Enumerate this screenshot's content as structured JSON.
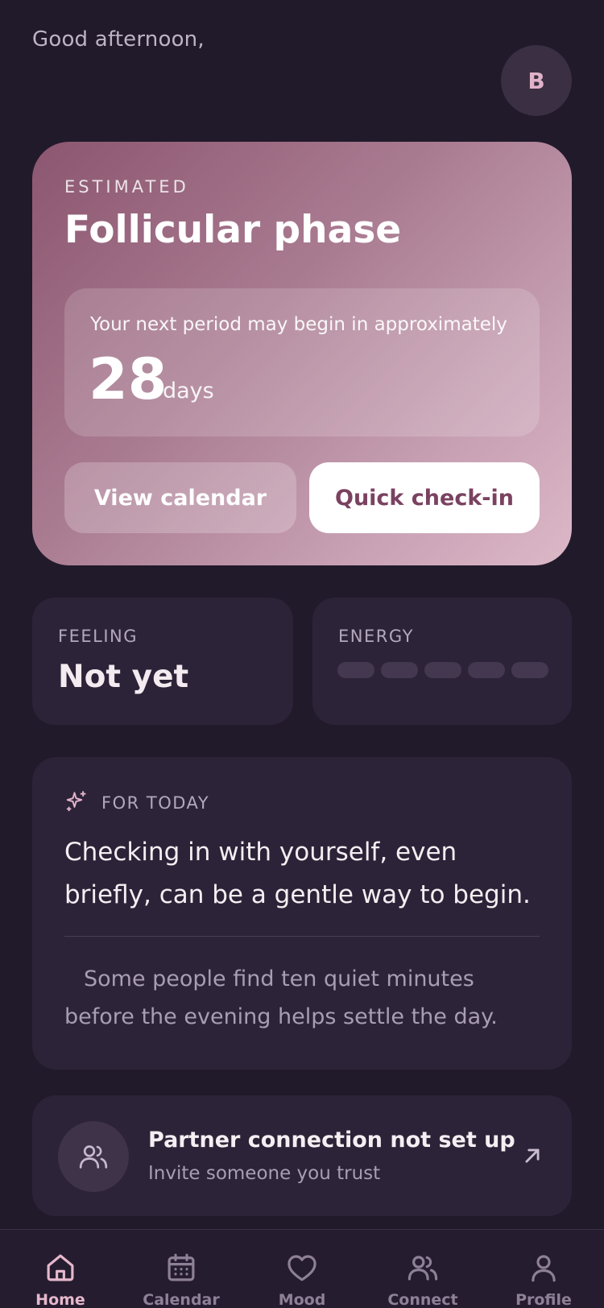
{
  "header": {
    "greeting": "Good afternoon,",
    "avatar_initial": "B"
  },
  "phase_card": {
    "eyebrow": "ESTIMATED",
    "title": "Follicular phase",
    "next_period_text": "Your next period may begin in approximately",
    "days_value": "28",
    "days_unit": "days",
    "view_calendar_label": "View calendar",
    "quick_checkin_label": "Quick check-in"
  },
  "stats": {
    "feeling_label": "FEELING",
    "feeling_value": "Not yet",
    "energy_label": "ENERGY",
    "energy_level": 0,
    "energy_max": 5
  },
  "for_today": {
    "label": "FOR TODAY",
    "main_text": "Checking in with yourself, even briefly, can be a gentle way to begin.",
    "sub_text": "Some people find ten quiet minutes before the evening helps settle the day."
  },
  "partner": {
    "title": "Partner connection not set up",
    "subtitle": "Invite someone you trust"
  },
  "tabs": [
    {
      "label": "Home",
      "icon": "home-icon",
      "active": true
    },
    {
      "label": "Calendar",
      "icon": "calendar-icon",
      "active": false
    },
    {
      "label": "Mood",
      "icon": "heart-icon",
      "active": false
    },
    {
      "label": "Connect",
      "icon": "users-icon",
      "active": false
    },
    {
      "label": "Profile",
      "icon": "person-icon",
      "active": false
    }
  ],
  "colors": {
    "background": "#211a2b",
    "card": "#2d2338",
    "accent": "#e6b8cc",
    "phase_gradient_start": "#8c5670",
    "phase_gradient_end": "#dcb8c7"
  }
}
